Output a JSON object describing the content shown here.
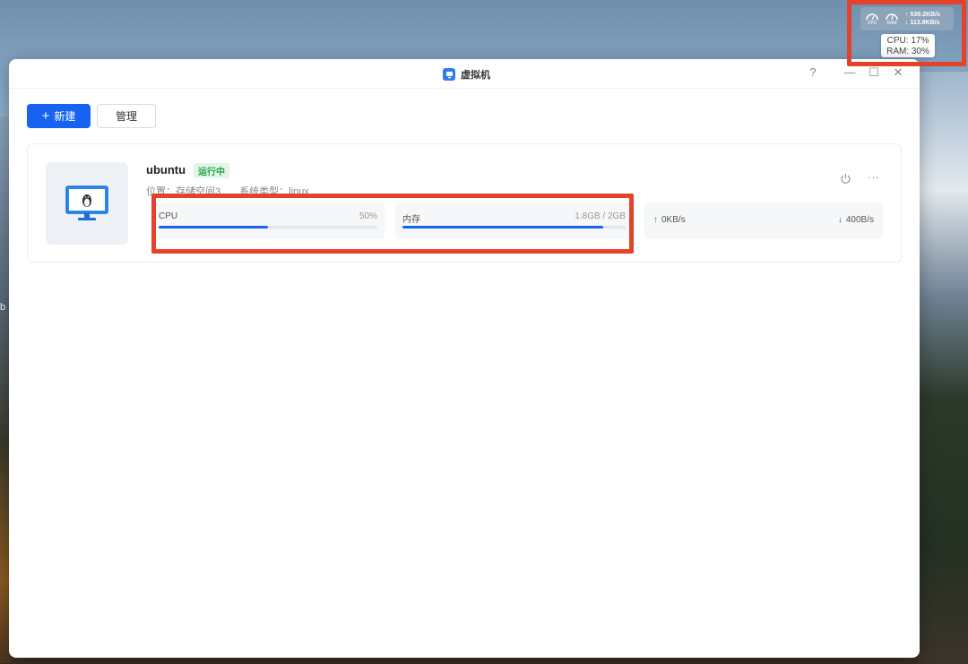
{
  "desktop": {
    "edge_letter": "b"
  },
  "widget": {
    "cpu_label": "CPU",
    "ram_label": "RAM",
    "upload": "539.2KB/s",
    "download": "113.8KB/s",
    "tooltip_cpu": "CPU: 17%",
    "tooltip_ram": "RAM: 30%"
  },
  "window": {
    "title": "虚拟机",
    "help": "?",
    "minimize": "—",
    "maximize": "☐",
    "close": "✕"
  },
  "toolbar": {
    "new_label": "新建",
    "manage_label": "管理"
  },
  "vm": {
    "name": "ubuntu",
    "status": "运行中",
    "location": "位置：存储空间3",
    "os_type": "系统类型：linux",
    "cpu": {
      "label": "CPU",
      "value": "50%",
      "fill": 0.5
    },
    "memory": {
      "label": "内存",
      "value": "1.8GB / 2GB",
      "fill": 0.9
    },
    "net_up": "0KB/s",
    "net_down": "400B/s"
  },
  "colors": {
    "accent": "#1763f0",
    "running": "#27a046",
    "highlight": "#e2432a"
  }
}
